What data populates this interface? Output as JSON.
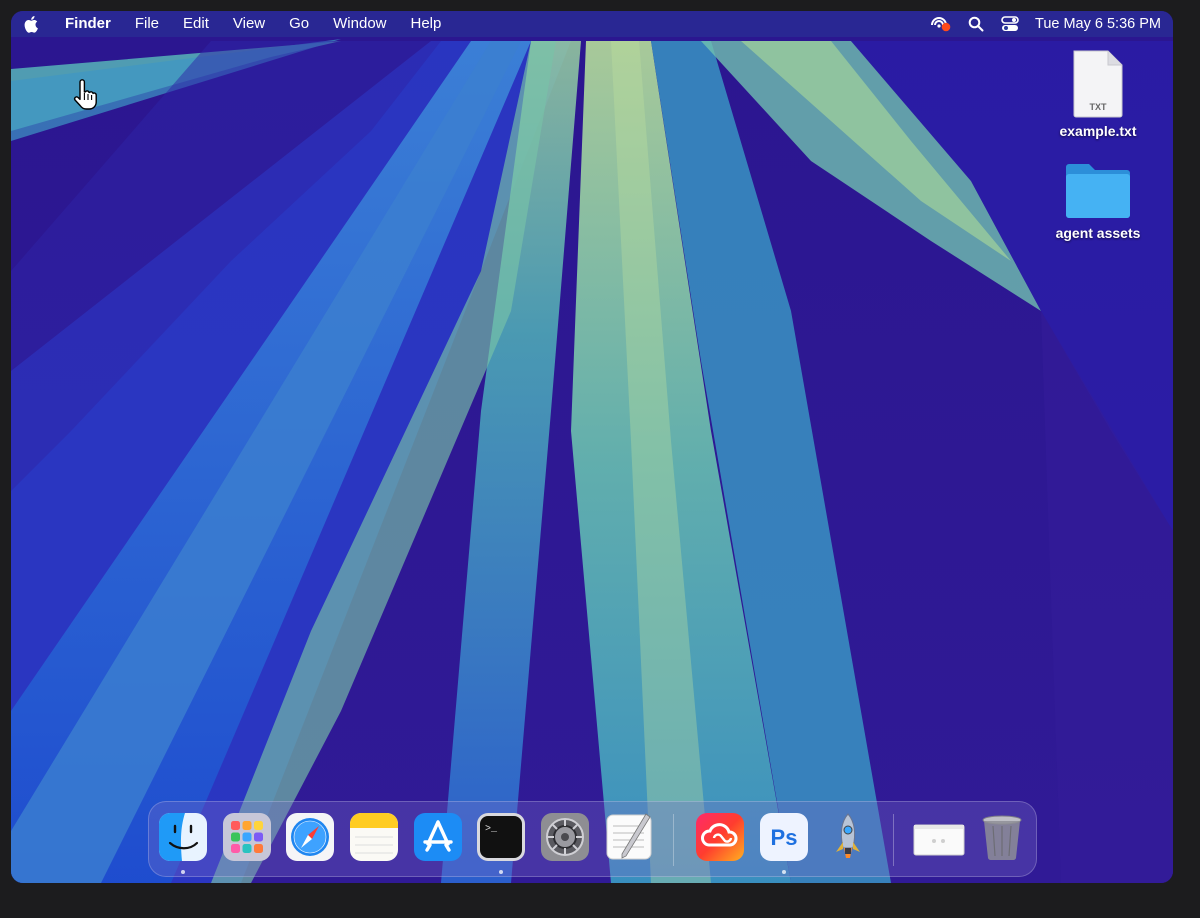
{
  "menubar": {
    "items": [
      {
        "label": "Finder",
        "bold": true
      },
      {
        "label": "File"
      },
      {
        "label": "Edit"
      },
      {
        "label": "View"
      },
      {
        "label": "Go"
      },
      {
        "label": "Window"
      },
      {
        "label": "Help"
      }
    ],
    "status_icons": [
      "screen-recording-icon",
      "spotlight-search-icon",
      "control-center-icon"
    ],
    "clock": "Tue May 6  5:36 PM"
  },
  "desktop": {
    "icons": [
      {
        "label": "example.txt",
        "icon": "text-file-icon",
        "badge": "TXT"
      },
      {
        "label": "agent assets",
        "icon": "folder-icon"
      }
    ]
  },
  "dock": {
    "apps": [
      {
        "name": "Finder",
        "icon": "finder-icon",
        "running": true
      },
      {
        "name": "Launchpad",
        "icon": "launchpad-icon",
        "running": false
      },
      {
        "name": "Safari",
        "icon": "safari-icon",
        "running": false
      },
      {
        "name": "Notes",
        "icon": "notes-icon",
        "running": false
      },
      {
        "name": "App Store",
        "icon": "app-store-icon",
        "running": false
      },
      {
        "name": "Terminal",
        "icon": "terminal-icon",
        "running": true
      },
      {
        "name": "System Settings",
        "icon": "system-settings-icon",
        "running": false
      },
      {
        "name": "TextEdit",
        "icon": "textedit-icon",
        "running": false
      },
      {
        "name": "Creative Cloud",
        "icon": "creative-cloud-icon",
        "running": false
      },
      {
        "name": "Photoshop",
        "icon": "photoshop-icon",
        "running": true,
        "text": "Ps"
      },
      {
        "name": "Rocket Typist",
        "icon": "rocket-icon",
        "running": false
      }
    ],
    "others": [
      {
        "name": "Window Preview",
        "icon": "window-thumbnail-icon"
      },
      {
        "name": "Trash",
        "icon": "trash-icon"
      }
    ]
  },
  "colors": {
    "wallpaper_base": "#2a1a8c",
    "wallpaper_light": "#a8d79a",
    "wallpaper_teal": "#3fa1c0",
    "wallpaper_blue": "#1a55d6",
    "menubar": "#2b3a9c",
    "folder": "#3aa9ef"
  }
}
